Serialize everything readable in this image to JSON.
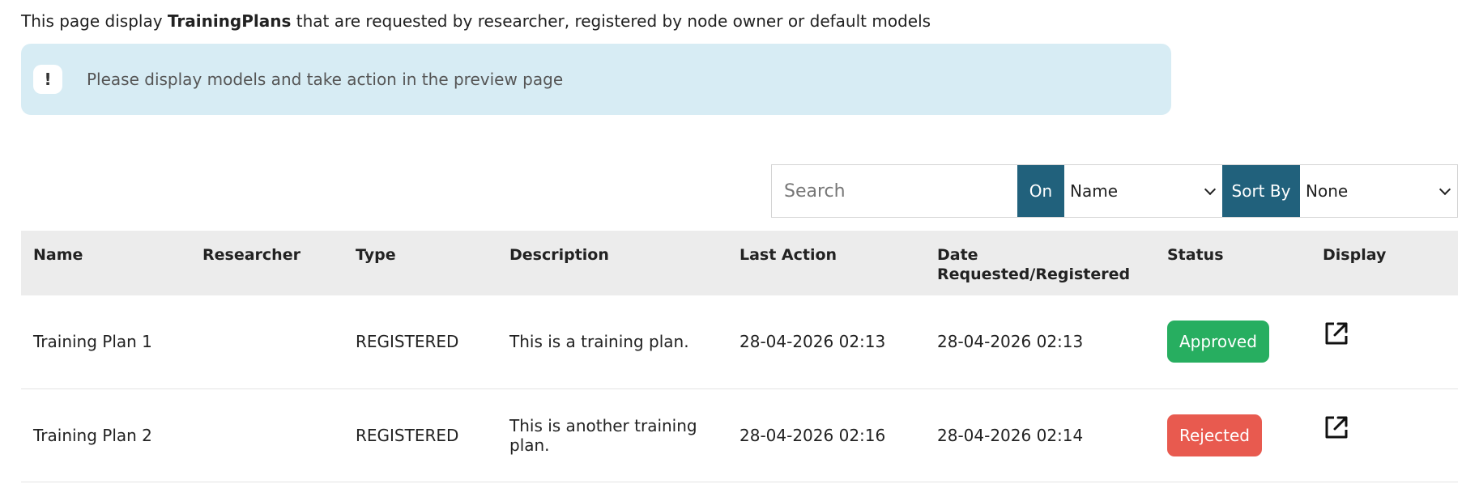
{
  "intro": {
    "prefix": "This page display ",
    "strong": "TrainingPlans",
    "suffix": " that are requested by researcher, registered by node owner or default models"
  },
  "alert": {
    "icon": "!",
    "icon_name": "exclamation-icon",
    "text": "Please display models and take action in the preview page"
  },
  "toolbar": {
    "search_placeholder": "Search",
    "on_label": "On",
    "on_selected": "Name",
    "sort_label": "Sort By",
    "sort_selected": "None"
  },
  "table": {
    "headers": {
      "name": "Name",
      "researcher": "Researcher",
      "type": "Type",
      "description": "Description",
      "last_action": "Last Action",
      "date_line1": "Date",
      "date_line2": "Requested/Registered",
      "status": "Status",
      "display": "Display"
    },
    "rows": [
      {
        "name": "Training Plan 1",
        "researcher": "",
        "type": "REGISTERED",
        "description": "This is a training plan.",
        "last_action": "28-04-2026 02:13",
        "date": "28-04-2026 02:13",
        "status": "Approved"
      },
      {
        "name": "Training Plan 2",
        "researcher": "",
        "type": "REGISTERED",
        "description": "This is another training plan.",
        "last_action": "28-04-2026 02:16",
        "date": "28-04-2026 02:14",
        "status": "Rejected"
      }
    ]
  },
  "colors": {
    "accent": "#21617c",
    "alert_bg": "#d7ecf4",
    "approved": "#27ae60",
    "rejected": "#e85a4f",
    "header_bg": "#ececec"
  },
  "icons": {
    "display": "external-link-icon"
  }
}
